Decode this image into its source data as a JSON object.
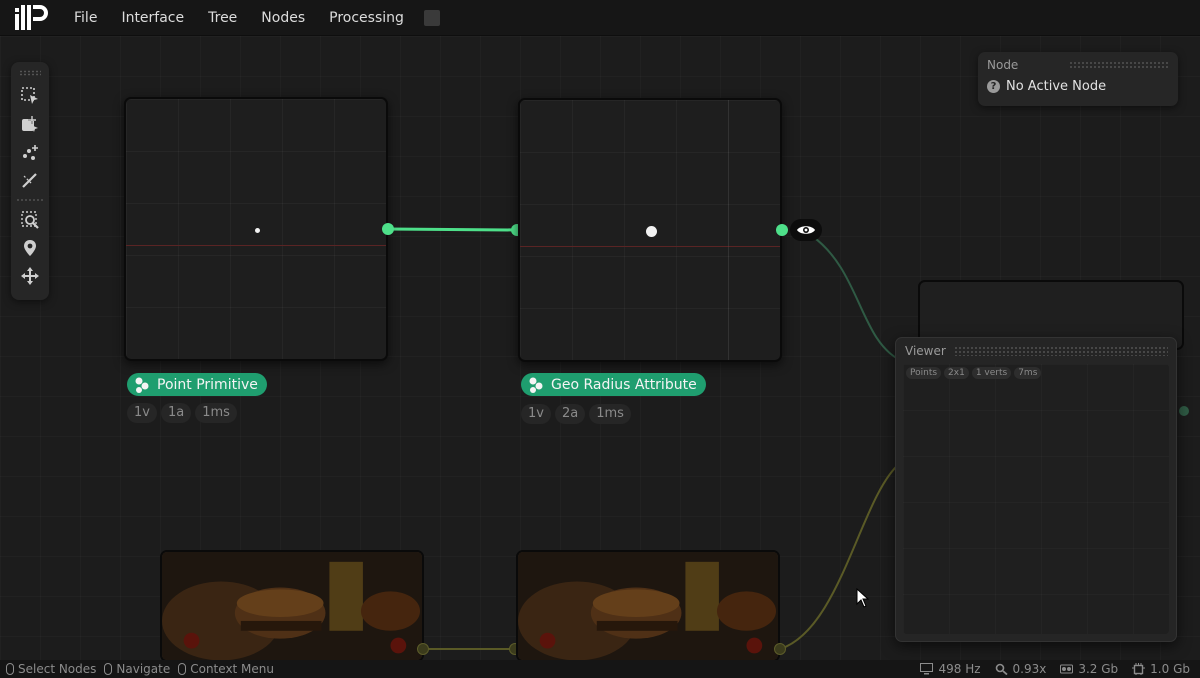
{
  "menu": {
    "items": [
      "File",
      "Interface",
      "Tree",
      "Nodes",
      "Processing"
    ]
  },
  "node_panel": {
    "title": "Node",
    "status": "No Active Node"
  },
  "nodes": {
    "point_primitive": {
      "label": "Point Primitive",
      "chips": [
        "1v",
        "1a",
        "1ms"
      ]
    },
    "geo_radius": {
      "label": "Geo Radius Attribute",
      "chips": [
        "1v",
        "2a",
        "1ms"
      ]
    }
  },
  "viewer": {
    "title": "Viewer",
    "chips": [
      "Points",
      "2x1",
      "1 verts",
      "7ms"
    ]
  },
  "statusbar": {
    "select": "Select Nodes",
    "navigate": "Navigate",
    "context": "Context Menu",
    "fps": "498 Hz",
    "zoom": "0.93x",
    "vram": "3.2 Gb",
    "ram": "1.0 Gb"
  },
  "colors": {
    "accent": "#1f9e6f",
    "socket": "#4ee08a",
    "wire_green": "#4ee08a",
    "wire_olive": "#6b6b2a"
  }
}
